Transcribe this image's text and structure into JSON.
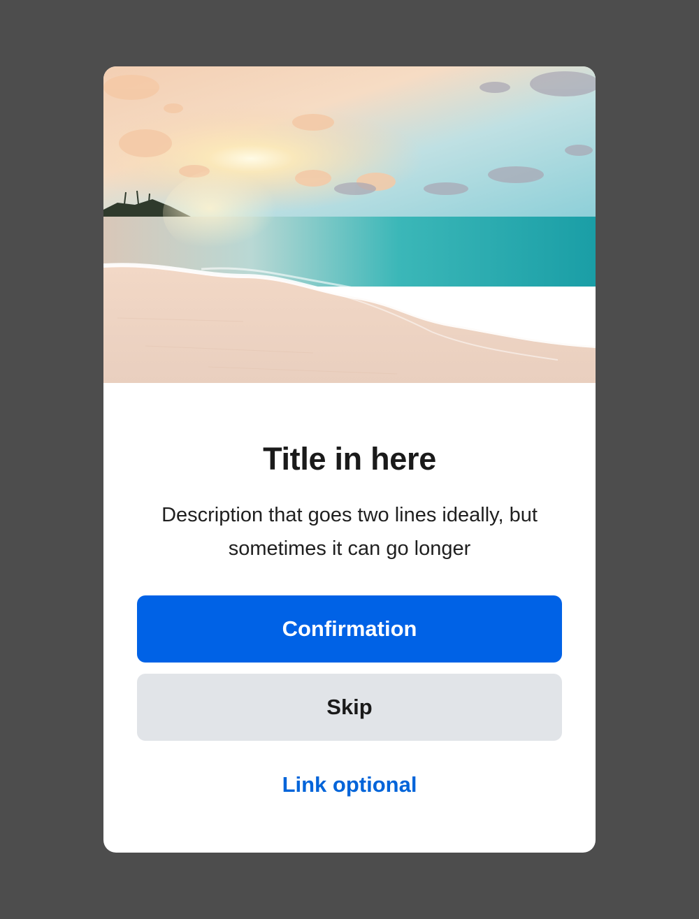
{
  "dialog": {
    "title": "Title in here",
    "description": "Description that goes two lines ideally, but sometimes it can go longer",
    "primary_button": "Confirmation",
    "secondary_button": "Skip",
    "link": "Link optional"
  },
  "colors": {
    "backdrop": "#4d4d4d",
    "card": "#ffffff",
    "primary": "#0062e6",
    "secondary": "#e1e4e8",
    "link": "#0064d9",
    "title": "#1a1a1a"
  },
  "icons": {
    "hero": "beach-sunset-image"
  }
}
